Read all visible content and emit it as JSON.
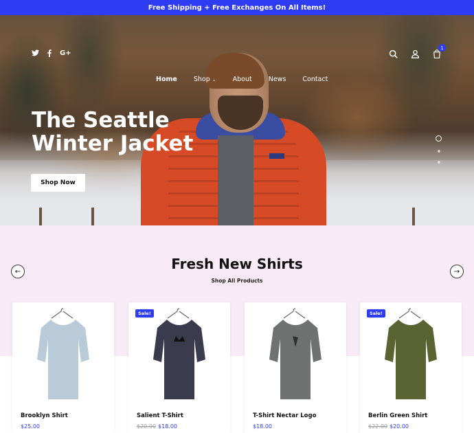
{
  "announcement": "Free Shipping + Free Exchanges On All Items!",
  "social_icons": [
    "twitter-icon",
    "facebook-icon",
    "google-plus-icon"
  ],
  "header_icons": [
    "search-icon",
    "user-icon",
    "cart-icon"
  ],
  "cart_count": "1",
  "nav": {
    "items": [
      "Home",
      "Shop",
      "About",
      "News",
      "Contact"
    ],
    "active": "Home"
  },
  "hero": {
    "title_line1": "The Seattle",
    "title_line2": "Winter Jacket",
    "button": "Shop Now",
    "slides": 3,
    "active_slide": 1
  },
  "section": {
    "title": "Fresh New Shirts",
    "link": "Shop All Products"
  },
  "products": [
    {
      "name": "Brooklyn Shirt",
      "sale": "",
      "old_price": "",
      "price": "$25.00",
      "color": "#b9cbd8"
    },
    {
      "name": "Salient T-Shirt",
      "sale": "Sale!",
      "old_price": "$20.00",
      "price": "$18.00",
      "color": "#3a3c4e"
    },
    {
      "name": "T-Shirt Nectar Logo",
      "sale": "",
      "old_price": "",
      "price": "$18.00",
      "color": "#707271"
    },
    {
      "name": "Berlin Green Shirt",
      "sale": "Sale!",
      "old_price": "$22.00",
      "price": "$20.00",
      "color": "#5a6433"
    }
  ],
  "colors": {
    "accent": "#2e3cf3",
    "section_bg": "#f8eaf6"
  }
}
